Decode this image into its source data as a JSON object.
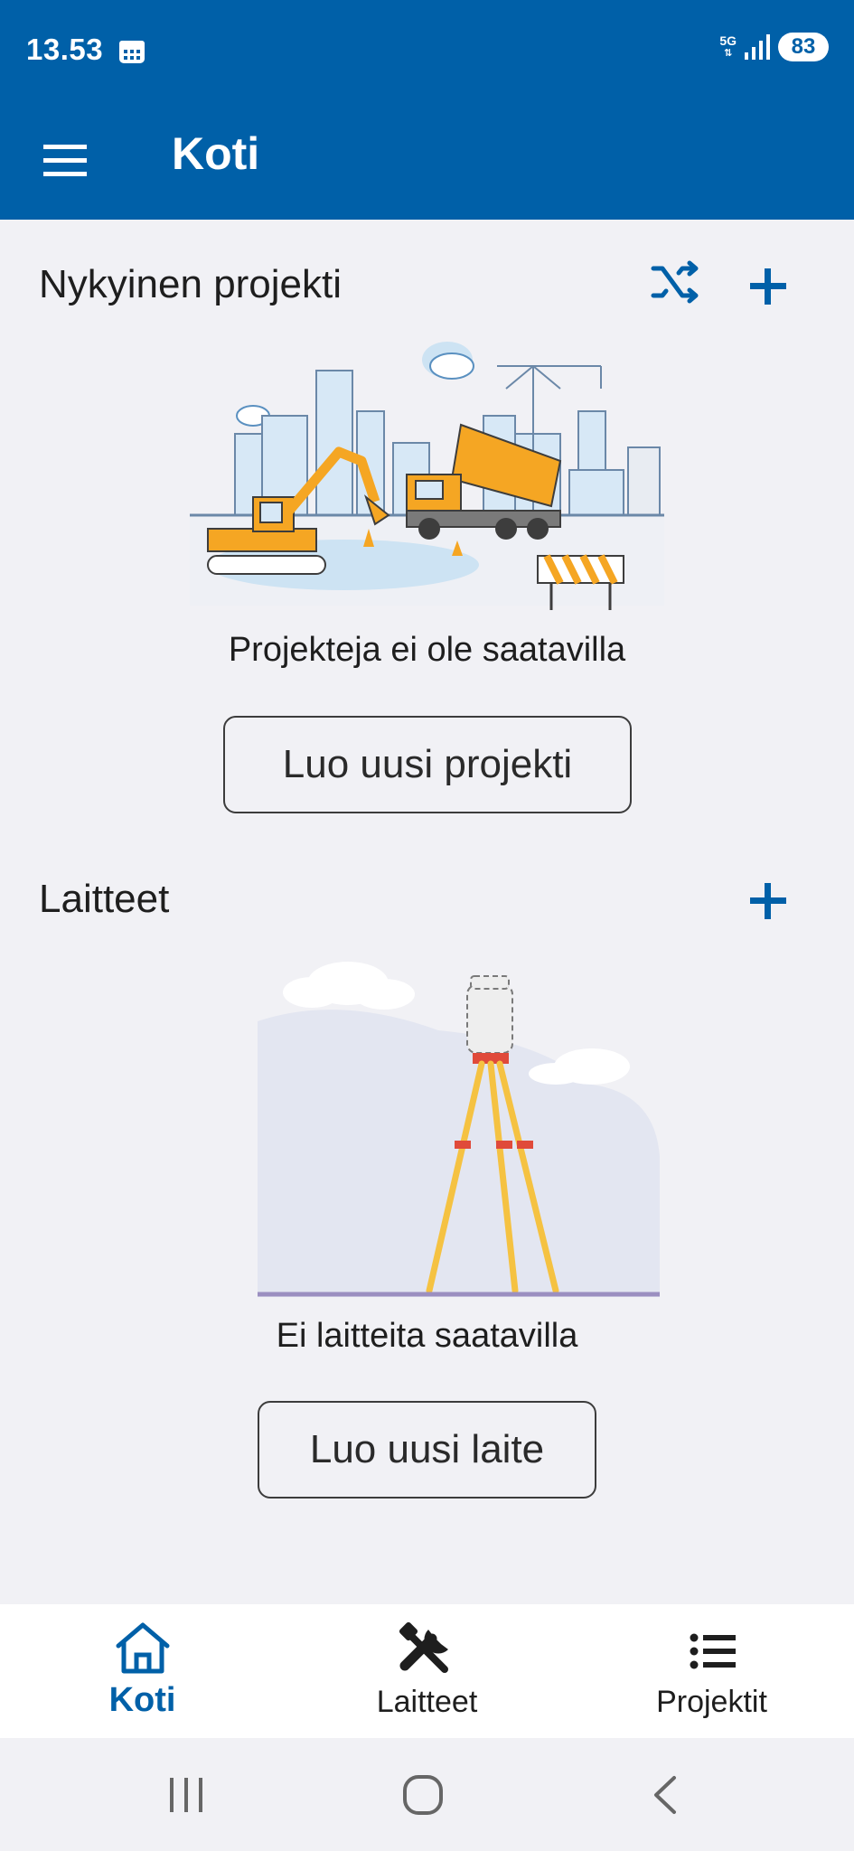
{
  "status_bar": {
    "time": "13.53",
    "network": "5G",
    "battery": "83"
  },
  "app_bar": {
    "title": "Koti",
    "menu_icon": "menu-icon"
  },
  "current_project": {
    "title": "Nykyinen projekti",
    "switch_icon": "swap-icon",
    "add_icon": "plus-icon",
    "empty_text": "Projekteja ei ole saatavilla",
    "create_button": "Luo uusi projekti"
  },
  "devices": {
    "title": "Laitteet",
    "add_icon": "plus-icon",
    "empty_text": "Ei laitteita saatavilla",
    "create_button": "Luo uusi laite"
  },
  "bottom_nav": {
    "items": [
      {
        "label": "Koti",
        "icon": "home-icon",
        "active": true
      },
      {
        "label": "Laitteet",
        "icon": "tools-icon",
        "active": false
      },
      {
        "label": "Projektit",
        "icon": "list-icon",
        "active": false
      }
    ]
  },
  "colors": {
    "primary": "#0060a8",
    "background": "#f1f1f5"
  }
}
